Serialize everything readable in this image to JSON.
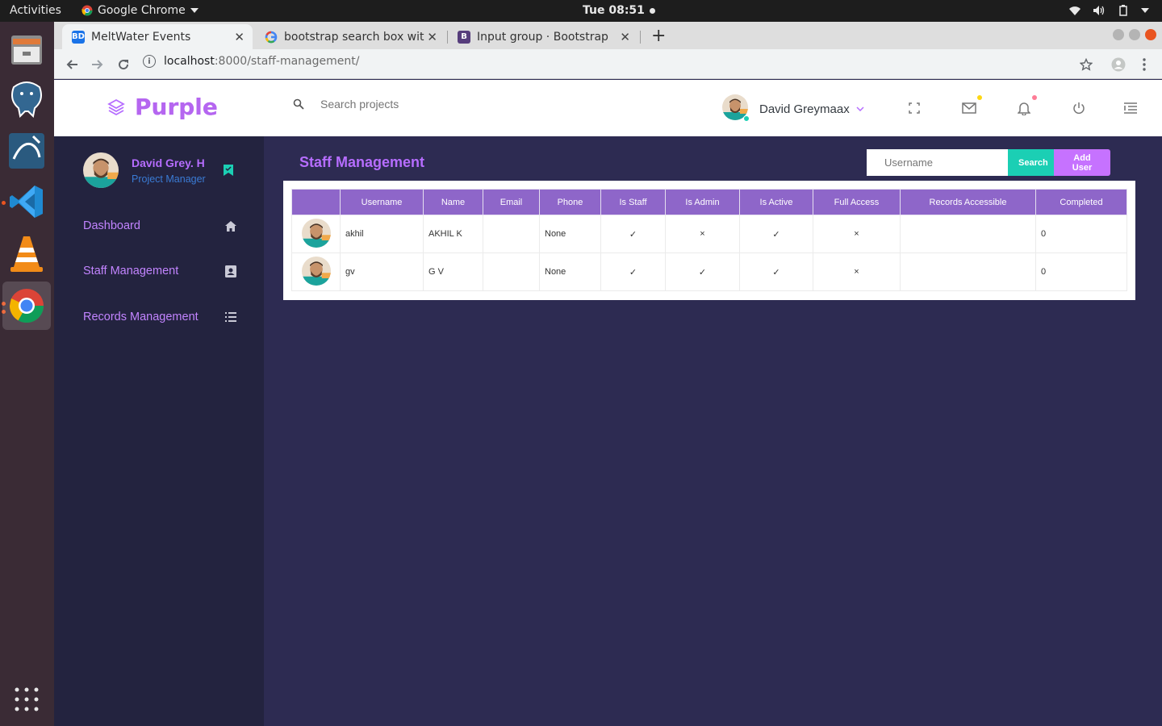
{
  "desktop": {
    "activities": "Activities",
    "app_name": "Google Chrome",
    "clock": "Tue 08:51"
  },
  "browser": {
    "tabs": [
      {
        "title": "MeltWater Events",
        "favicon": "BD",
        "active": true
      },
      {
        "title": "bootstrap search box wit",
        "favicon": "google-icon",
        "active": false
      },
      {
        "title": "Input group · Bootstrap",
        "favicon": "B",
        "active": false
      }
    ],
    "url_host": "localhost",
    "url_path": ":8000/staff-management/"
  },
  "navbar": {
    "brand": "Purple",
    "search_placeholder": "Search projects",
    "profile_name": "David Greymaax"
  },
  "sidebar": {
    "user_name": "David Grey. H",
    "user_role": "Project Manager",
    "items": [
      {
        "label": "Dashboard",
        "icon": "home-icon"
      },
      {
        "label": "Staff Management",
        "icon": "contact-icon"
      },
      {
        "label": "Records Management",
        "icon": "list-icon"
      }
    ]
  },
  "main": {
    "title": "Staff Management",
    "username_placeholder": "Username",
    "search_label": "Search",
    "add_user_label": "Add User",
    "table": {
      "headers": [
        "",
        "Username",
        "Name",
        "Email",
        "Phone",
        "Is Staff",
        "Is Admin",
        "Is Active",
        "Full Access",
        "Records Accessible",
        "Completed"
      ],
      "rows": [
        {
          "username": "akhil",
          "name": "AKHIL K",
          "email": "",
          "phone": "None",
          "is_staff": "✓",
          "is_admin": "×",
          "is_active": "✓",
          "full_access": "×",
          "records": "",
          "completed": "0"
        },
        {
          "username": "gv",
          "name": "G V",
          "email": "",
          "phone": "None",
          "is_staff": "✓",
          "is_admin": "✓",
          "is_active": "✓",
          "full_access": "×",
          "records": "",
          "completed": "0"
        }
      ]
    }
  },
  "colors": {
    "accent": "#b66dff",
    "table_header": "#8e66c9",
    "search_button": "#1bcfb4",
    "add_button": "#c672ff",
    "sidebar_bg": "#23233f",
    "content_bg": "#2d2b52"
  }
}
